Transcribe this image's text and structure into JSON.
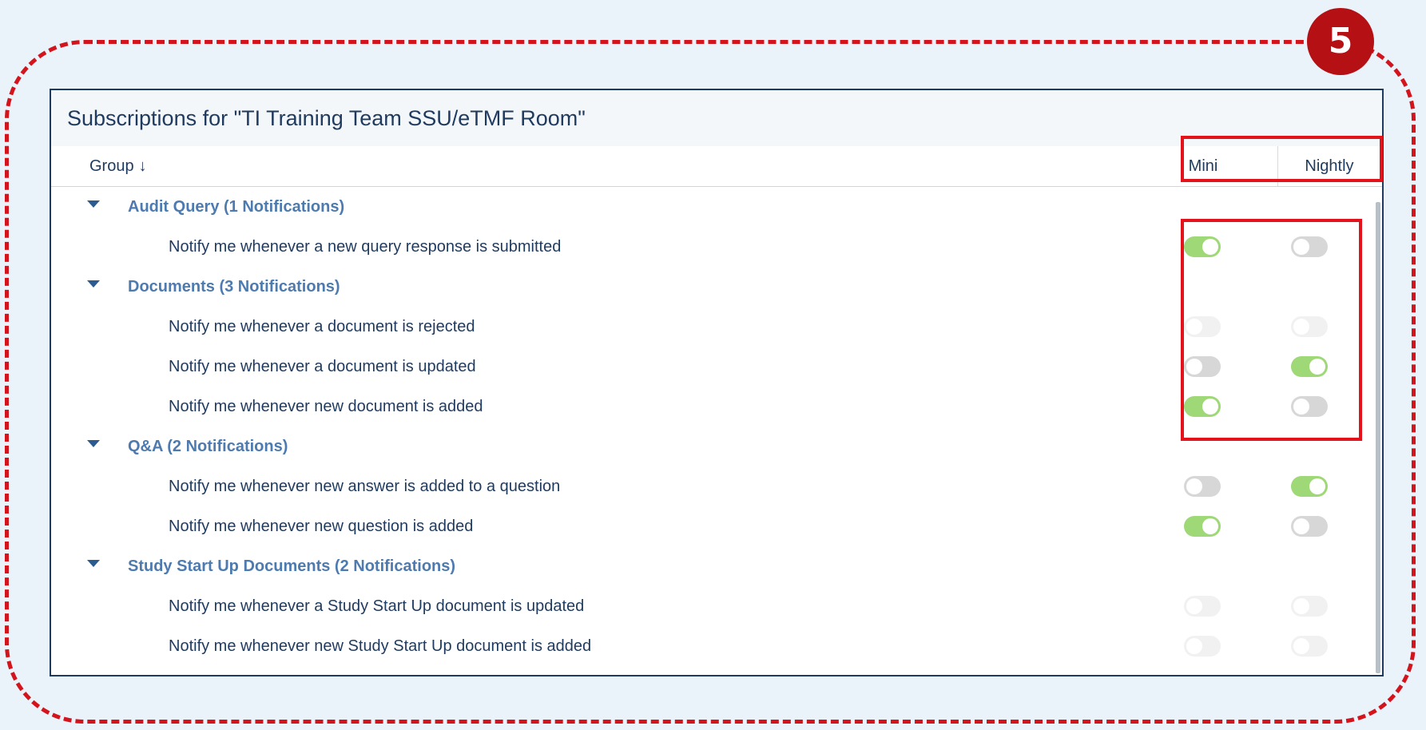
{
  "step_number": "5",
  "panel": {
    "title": "Subscriptions for \"TI Training Team SSU/eTMF Room\""
  },
  "columns": {
    "group_label": "Group",
    "sort_indicator": "↓",
    "mini_label": "Mini",
    "nightly_label": "Nightly"
  },
  "colors": {
    "toggle_on": "#9fd877",
    "toggle_off": "#d7d7d7",
    "toggle_disabled": "#f1f1f1",
    "highlight": "#e3121b",
    "group_text": "#4d7aaf"
  },
  "icons": {
    "collapse": "caret-down-icon",
    "sort": "arrow-down-icon"
  },
  "groups": [
    {
      "label": "Audit Query (1 Notifications)",
      "items": [
        {
          "label": "Notify me whenever a new query response is submitted",
          "mini": "on",
          "nightly": "off"
        }
      ]
    },
    {
      "label": "Documents (3 Notifications)",
      "items": [
        {
          "label": "Notify me whenever a document is rejected",
          "mini": "disabled",
          "nightly": "disabled"
        },
        {
          "label": "Notify me whenever a document is updated",
          "mini": "off",
          "nightly": "on"
        },
        {
          "label": "Notify me whenever new document is added",
          "mini": "on",
          "nightly": "off"
        }
      ]
    },
    {
      "label": "Q&A (2 Notifications)",
      "items": [
        {
          "label": "Notify me whenever new answer is added to a question",
          "mini": "off",
          "nightly": "on"
        },
        {
          "label": "Notify me whenever new question is added",
          "mini": "on",
          "nightly": "off"
        }
      ]
    },
    {
      "label": "Study Start Up Documents (2 Notifications)",
      "items": [
        {
          "label": "Notify me whenever a Study Start Up document is updated",
          "mini": "disabled",
          "nightly": "disabled"
        },
        {
          "label": "Notify me whenever new Study Start Up document is added",
          "mini": "disabled",
          "nightly": "disabled"
        }
      ]
    }
  ]
}
